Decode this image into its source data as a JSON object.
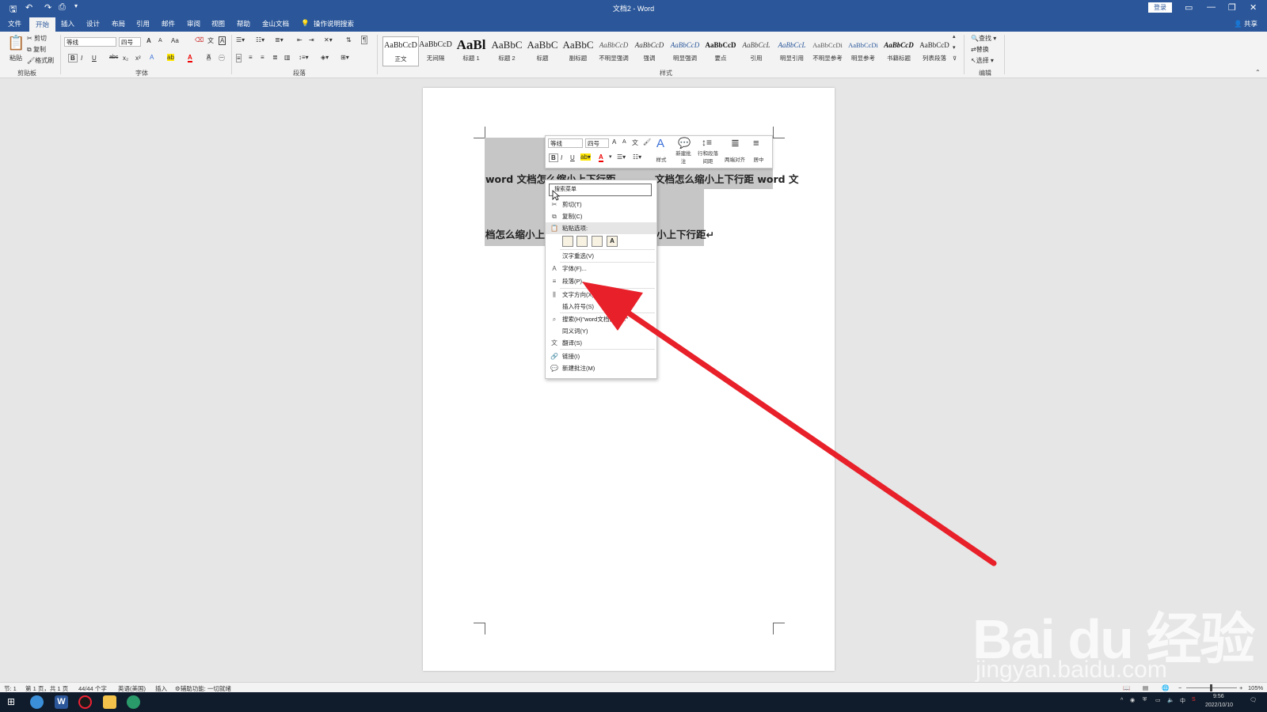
{
  "titlebar": {
    "title": "文档2 - Word",
    "login": "登录",
    "share": "共享"
  },
  "tabs": [
    "文件",
    "开始",
    "插入",
    "设计",
    "布局",
    "引用",
    "邮件",
    "审阅",
    "视图",
    "帮助",
    "金山文档",
    "操作说明搜索"
  ],
  "ribbon": {
    "clipboard": {
      "paste": "粘贴",
      "cut": "剪切",
      "copy": "复制",
      "format_painter": "格式刷",
      "label": "剪贴板"
    },
    "font": {
      "name": "等线",
      "size": "四号",
      "label": "字体",
      "bold": "B",
      "italic": "I",
      "underline": "U",
      "strike": "abc",
      "sub": "x₂",
      "sup": "x²",
      "aa": "Aa",
      "grow": "A",
      "shrink": "A"
    },
    "paragraph": {
      "label": "段落"
    },
    "styles": {
      "label": "样式",
      "items": [
        {
          "preview": "AaBbCcD",
          "name": "正文"
        },
        {
          "preview": "AaBbCcD",
          "name": "无间隔"
        },
        {
          "preview": "AaBl",
          "name": "标题 1"
        },
        {
          "preview": "AaBbC",
          "name": "标题 2"
        },
        {
          "preview": "AaBbC",
          "name": "标题"
        },
        {
          "preview": "AaBbC",
          "name": "副标题"
        },
        {
          "preview": "AaBbCcD",
          "name": "不明显强调"
        },
        {
          "preview": "AaBbCcD",
          "name": "强调"
        },
        {
          "preview": "AaBbCcD",
          "name": "明显强调"
        },
        {
          "preview": "AaBbCcD",
          "name": "要点"
        },
        {
          "preview": "AaBbCcL",
          "name": "引用"
        },
        {
          "preview": "AaBbCcL",
          "name": "明显引用"
        },
        {
          "preview": "AaBbCcDi",
          "name": "不明显参考"
        },
        {
          "preview": "AaBbCcDi",
          "name": "明显参考"
        },
        {
          "preview": "AaBbCcD",
          "name": "书籍标题"
        },
        {
          "preview": "AaBbCcD",
          "name": "列表段落"
        }
      ]
    },
    "editing": {
      "find": "查找",
      "replace": "替换",
      "select": "选择",
      "label": "编辑"
    }
  },
  "document": {
    "line1": "word 文档怎么缩小上下行距",
    "line1_right": "文档怎么缩小上下行距 word 文",
    "line2_left": "档怎么缩小上",
    "line2_right": "小上下行距↵"
  },
  "mini_toolbar": {
    "font": "等线",
    "size": "四号",
    "styles": "样式",
    "new_comment": "新建批注",
    "line_spacing": "行和段落间距",
    "justify": "两端对齐",
    "center": "居中"
  },
  "context_menu": {
    "search_placeholder": "搜索菜单",
    "items": [
      "剪切(T)",
      "复制(C)",
      "粘贴选项:",
      "汉字重选(V)",
      "字体(F)...",
      "段落(P)...",
      "文字方向(X)...",
      "插入符号(S)",
      "搜索(H)\"word文档怎么...\"",
      "同义词(Y)",
      "翻译(S)",
      "链接(I)",
      "新建批注(M)"
    ]
  },
  "statusbar": {
    "section": "节: 1",
    "page": "第 1 页，共 1 页",
    "words": "44/44 个字",
    "language": "英语(美国)",
    "mode": "插入",
    "accessibility": "辅助功能: 一切就绪",
    "zoom": "105%"
  },
  "taskbar": {
    "time": "9:56",
    "date": "2022/10/10",
    "ime": "中"
  },
  "watermark": {
    "logo": "Bai du 经验",
    "url": "jingyan.baidu.com"
  },
  "colors": {
    "accent": "#2b579a",
    "arrow": "#e8202a",
    "selection": "#c6c6c6"
  }
}
